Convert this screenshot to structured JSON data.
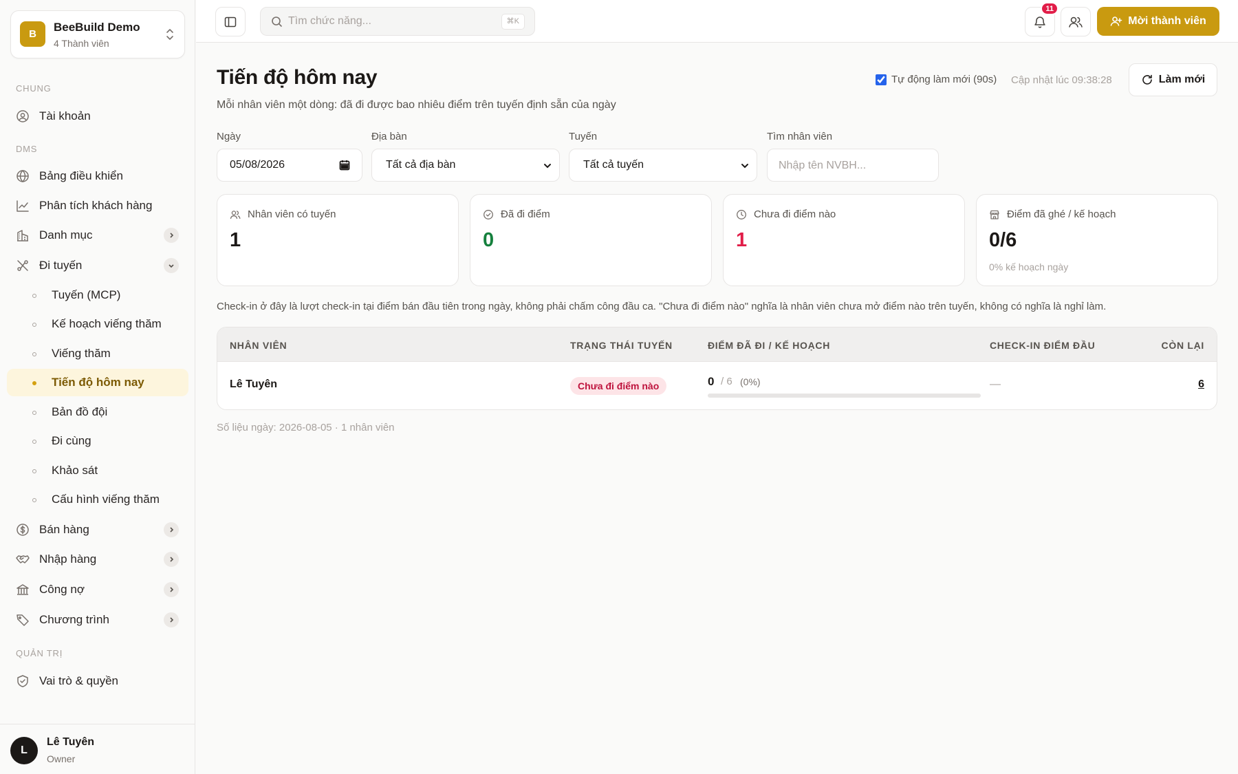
{
  "workspace": {
    "name": "BeeBuild Demo",
    "members": "4 Thành viên",
    "logo_letter": "B"
  },
  "sidebar": {
    "sections": {
      "chung": "CHUNG",
      "dms": "DMS",
      "quan_tri": "QUẢN TRỊ"
    },
    "tai_khoan": "Tài khoản",
    "bang_dieu_khien": "Bảng điều khiển",
    "phan_tich": "Phân tích khách hàng",
    "danh_muc": "Danh mục",
    "di_tuyen": "Đi tuyến",
    "sub": [
      "Tuyến (MCP)",
      "Kế hoạch viếng thăm",
      "Viếng thăm",
      "Tiến độ hôm nay",
      "Bản đồ đội",
      "Đi cùng",
      "Khảo sát",
      "Cấu hình viếng thăm"
    ],
    "ban_hang": "Bán hàng",
    "nhap_hang": "Nhập hàng",
    "cong_no": "Công nợ",
    "chuong_trinh": "Chương trình",
    "vai_tro": "Vai trò & quyền"
  },
  "user": {
    "name": "Lê Tuyên",
    "role": "Owner",
    "initial": "L"
  },
  "topbar": {
    "search_placeholder": "Tìm chức năng...",
    "search_shortcut": "⌘K",
    "notification_count": "11",
    "invite_label": "Mời thành viên"
  },
  "page": {
    "title": "Tiến độ hôm nay",
    "subtitle": "Mỗi nhân viên một dòng: đã đi được bao nhiêu điểm trên tuyến định sẵn của ngày",
    "auto_refresh_label": "Tự động làm mới (90s)",
    "auto_refresh_checked": true,
    "updated_at": "Cập nhật lúc 09:38:28",
    "refresh_label": "Làm mới"
  },
  "filters": {
    "date_label": "Ngày",
    "date_value": "05/08/2026",
    "area_label": "Địa bàn",
    "area_value": "Tất cả địa bàn",
    "route_label": "Tuyến",
    "route_value": "Tất cả tuyến",
    "staff_label": "Tìm nhân viên",
    "staff_placeholder": "Nhập tên NVBH..."
  },
  "cards": [
    {
      "label": "Nhân viên có tuyến",
      "value": "1",
      "color": "#1c1917"
    },
    {
      "label": "Đã đi điểm",
      "value": "0",
      "color": "#15803d"
    },
    {
      "label": "Chưa đi điểm nào",
      "value": "1",
      "color": "#e11d48"
    },
    {
      "label": "Điểm đã ghé / kế hoạch",
      "value": "0/6",
      "note": "0% kế hoạch ngày",
      "color": "#1c1917"
    }
  ],
  "info_text": "Check-in ở đây là lượt check-in tại điểm bán đầu tiên trong ngày, không phải chấm công đầu ca. \"Chưa đi điểm nào\" nghĩa là nhân viên chưa mở điểm nào trên tuyến, không có nghĩa là nghỉ làm.",
  "table": {
    "headers": {
      "staff": "NHÂN VIÊN",
      "status": "TRẠNG THÁI TUYẾN",
      "points": "ĐIỂM ĐÃ ĐI / KẾ HOẠCH",
      "checkin": "CHECK-IN ĐIỂM ĐẦU",
      "remaining": "CÒN LẠI"
    },
    "rows": [
      {
        "staff": "Lê Tuyên",
        "status": "Chưa đi điểm nào",
        "done": "0",
        "plan": "/ 6",
        "percent": "(0%)",
        "progress": 0,
        "checkin": "—",
        "remaining": "6"
      }
    ]
  },
  "footer_note": "Số liệu ngày: 2026-08-05 · 1 nhân viên"
}
